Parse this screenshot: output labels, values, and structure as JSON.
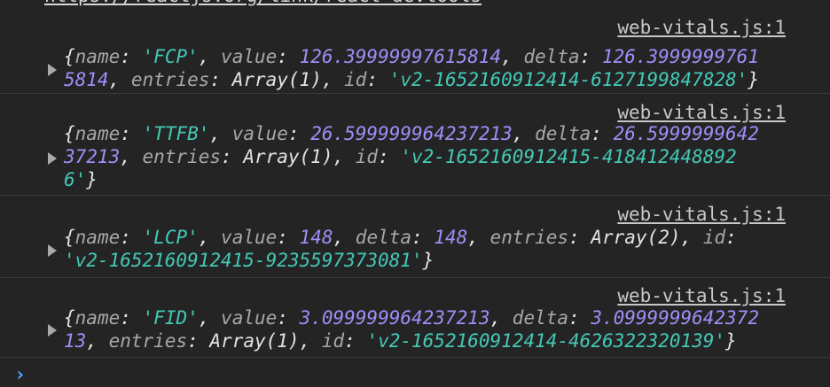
{
  "top_link_partial": "https://reactjs.org/link/react-devtools",
  "entries": [
    {
      "source": "web-vitals.js:1",
      "lines": [
        [
          {
            "t": "p",
            "v": "{"
          },
          {
            "t": "k",
            "v": "name"
          },
          {
            "t": "p",
            "v": ": "
          },
          {
            "t": "s",
            "v": "'FCP'"
          },
          {
            "t": "p",
            "v": ", "
          },
          {
            "t": "k",
            "v": "value"
          },
          {
            "t": "p",
            "v": ": "
          },
          {
            "t": "n",
            "v": "126.39999997615814"
          },
          {
            "t": "p",
            "v": ", "
          },
          {
            "t": "k",
            "v": "delta"
          },
          {
            "t": "p",
            "v": ": "
          },
          {
            "t": "n",
            "v": "126.3999999761"
          }
        ],
        [
          {
            "t": "n",
            "v": "5814"
          },
          {
            "t": "p",
            "v": ", "
          },
          {
            "t": "k",
            "v": "entries"
          },
          {
            "t": "p",
            "v": ": "
          },
          {
            "t": "t",
            "v": "Array(1)"
          },
          {
            "t": "p",
            "v": ", "
          },
          {
            "t": "k",
            "v": "id"
          },
          {
            "t": "p",
            "v": ": "
          },
          {
            "t": "s",
            "v": "'v2-1652160912414-6127199847828'"
          },
          {
            "t": "p",
            "v": "}"
          }
        ]
      ]
    },
    {
      "source": "web-vitals.js:1",
      "lines": [
        [
          {
            "t": "p",
            "v": "{"
          },
          {
            "t": "k",
            "v": "name"
          },
          {
            "t": "p",
            "v": ": "
          },
          {
            "t": "s",
            "v": "'TTFB'"
          },
          {
            "t": "p",
            "v": ", "
          },
          {
            "t": "k",
            "v": "value"
          },
          {
            "t": "p",
            "v": ": "
          },
          {
            "t": "n",
            "v": "26.599999964237213"
          },
          {
            "t": "p",
            "v": ", "
          },
          {
            "t": "k",
            "v": "delta"
          },
          {
            "t": "p",
            "v": ": "
          },
          {
            "t": "n",
            "v": "26.5999999642"
          }
        ],
        [
          {
            "t": "n",
            "v": "37213"
          },
          {
            "t": "p",
            "v": ", "
          },
          {
            "t": "k",
            "v": "entries"
          },
          {
            "t": "p",
            "v": ": "
          },
          {
            "t": "t",
            "v": "Array(1)"
          },
          {
            "t": "p",
            "v": ", "
          },
          {
            "t": "k",
            "v": "id"
          },
          {
            "t": "p",
            "v": ": "
          },
          {
            "t": "s",
            "v": "'v2-1652160912415-418412448892"
          }
        ],
        [
          {
            "t": "s",
            "v": "6'"
          },
          {
            "t": "p",
            "v": "}"
          }
        ]
      ]
    },
    {
      "source": "web-vitals.js:1",
      "lines": [
        [
          {
            "t": "p",
            "v": "{"
          },
          {
            "t": "k",
            "v": "name"
          },
          {
            "t": "p",
            "v": ": "
          },
          {
            "t": "s",
            "v": "'LCP'"
          },
          {
            "t": "p",
            "v": ", "
          },
          {
            "t": "k",
            "v": "value"
          },
          {
            "t": "p",
            "v": ": "
          },
          {
            "t": "n",
            "v": "148"
          },
          {
            "t": "p",
            "v": ", "
          },
          {
            "t": "k",
            "v": "delta"
          },
          {
            "t": "p",
            "v": ": "
          },
          {
            "t": "n",
            "v": "148"
          },
          {
            "t": "p",
            "v": ", "
          },
          {
            "t": "k",
            "v": "entries"
          },
          {
            "t": "p",
            "v": ": "
          },
          {
            "t": "t",
            "v": "Array(2)"
          },
          {
            "t": "p",
            "v": ", "
          },
          {
            "t": "k",
            "v": "id"
          },
          {
            "t": "p",
            "v": ":"
          }
        ],
        [
          {
            "t": "s",
            "v": "'v2-1652160912415-9235597373081'"
          },
          {
            "t": "p",
            "v": "}"
          }
        ]
      ]
    },
    {
      "source": "web-vitals.js:1",
      "lines": [
        [
          {
            "t": "p",
            "v": "{"
          },
          {
            "t": "k",
            "v": "name"
          },
          {
            "t": "p",
            "v": ": "
          },
          {
            "t": "s",
            "v": "'FID'"
          },
          {
            "t": "p",
            "v": ", "
          },
          {
            "t": "k",
            "v": "value"
          },
          {
            "t": "p",
            "v": ": "
          },
          {
            "t": "n",
            "v": "3.099999964237213"
          },
          {
            "t": "p",
            "v": ", "
          },
          {
            "t": "k",
            "v": "delta"
          },
          {
            "t": "p",
            "v": ": "
          },
          {
            "t": "n",
            "v": "3.0999999642372"
          }
        ],
        [
          {
            "t": "n",
            "v": "13"
          },
          {
            "t": "p",
            "v": ", "
          },
          {
            "t": "k",
            "v": "entries"
          },
          {
            "t": "p",
            "v": ": "
          },
          {
            "t": "t",
            "v": "Array(1)"
          },
          {
            "t": "p",
            "v": ", "
          },
          {
            "t": "k",
            "v": "id"
          },
          {
            "t": "p",
            "v": ": "
          },
          {
            "t": "s",
            "v": "'v2-1652160912414-4626322320139'"
          },
          {
            "t": "p",
            "v": "}"
          }
        ]
      ]
    }
  ],
  "prompt_symbol": "›",
  "colors": {
    "background": "#242424",
    "string": "#43c9b6",
    "number": "#9d8ff7",
    "key": "#a8a8a8",
    "prompt": "#4ca3ff"
  }
}
